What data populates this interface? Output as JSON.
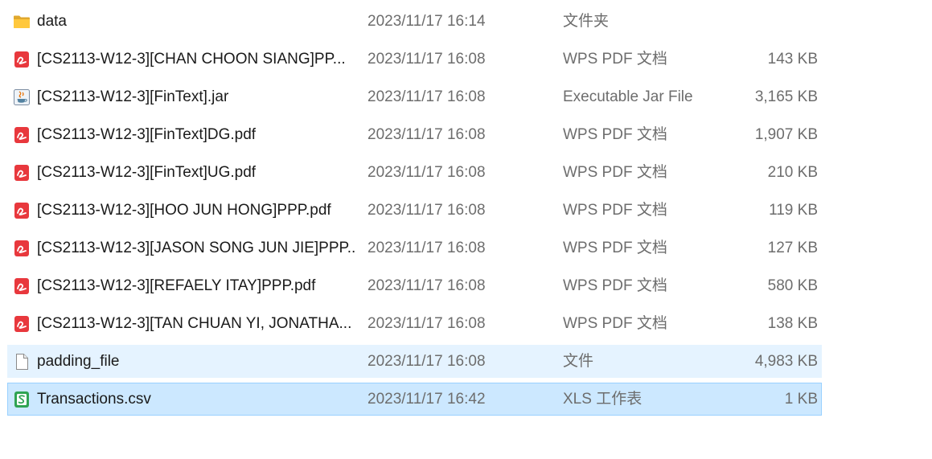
{
  "files": [
    {
      "name": "data",
      "date": "2023/11/17 16:14",
      "type": "文件夹",
      "size": "",
      "icon": "folder-icon",
      "state": "normal"
    },
    {
      "name": "[CS2113-W12-3][CHAN CHOON SIANG]PP...",
      "date": "2023/11/17 16:08",
      "type": "WPS PDF 文档",
      "size": "143 KB",
      "icon": "wps-pdf-icon",
      "state": "normal"
    },
    {
      "name": "[CS2113-W12-3][FinText].jar",
      "date": "2023/11/17 16:08",
      "type": "Executable Jar File",
      "size": "3,165 KB",
      "icon": "java-jar-icon",
      "state": "normal"
    },
    {
      "name": "[CS2113-W12-3][FinText]DG.pdf",
      "date": "2023/11/17 16:08",
      "type": "WPS PDF 文档",
      "size": "1,907 KB",
      "icon": "wps-pdf-icon",
      "state": "normal"
    },
    {
      "name": "[CS2113-W12-3][FinText]UG.pdf",
      "date": "2023/11/17 16:08",
      "type": "WPS PDF 文档",
      "size": "210 KB",
      "icon": "wps-pdf-icon",
      "state": "normal"
    },
    {
      "name": "[CS2113-W12-3][HOO JUN HONG]PPP.pdf",
      "date": "2023/11/17 16:08",
      "type": "WPS PDF 文档",
      "size": "119 KB",
      "icon": "wps-pdf-icon",
      "state": "normal"
    },
    {
      "name": "[CS2113-W12-3][JASON SONG JUN JIE]PPP...",
      "date": "2023/11/17 16:08",
      "type": "WPS PDF 文档",
      "size": "127 KB",
      "icon": "wps-pdf-icon",
      "state": "normal"
    },
    {
      "name": "[CS2113-W12-3][REFAELY ITAY]PPP.pdf",
      "date": "2023/11/17 16:08",
      "type": "WPS PDF 文档",
      "size": "580 KB",
      "icon": "wps-pdf-icon",
      "state": "normal"
    },
    {
      "name": "[CS2113-W12-3][TAN CHUAN YI, JONATHA...",
      "date": "2023/11/17 16:08",
      "type": "WPS PDF 文档",
      "size": "138 KB",
      "icon": "wps-pdf-icon",
      "state": "normal"
    },
    {
      "name": "padding_file",
      "date": "2023/11/17 16:08",
      "type": "文件",
      "size": "4,983 KB",
      "icon": "blank-file-icon",
      "state": "hover"
    },
    {
      "name": "Transactions.csv",
      "date": "2023/11/17 16:42",
      "type": "XLS 工作表",
      "size": "1 KB",
      "icon": "wps-spreadsheet-icon",
      "state": "selected"
    }
  ],
  "colors": {
    "hover_bg": "#e5f3ff",
    "selected_bg": "#cce8ff",
    "selected_border": "#99d1ff",
    "pdf_red": "#e8383d",
    "sheet_green": "#2fa352",
    "folder_yellow": "#ffc83d"
  }
}
